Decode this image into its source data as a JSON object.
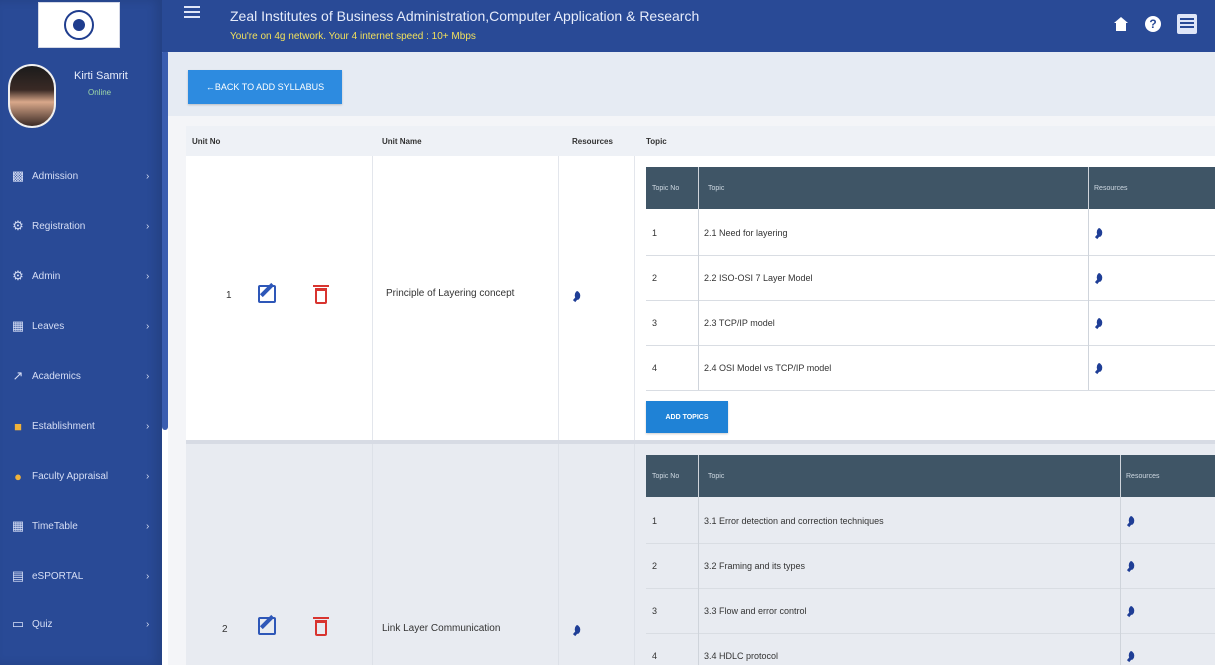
{
  "app": {
    "title": "Zeal Institutes of Business Administration,Computer Application & Research",
    "network_status": "You're on 4g network. Your 4 internet speed : 10+ Mbps"
  },
  "user": {
    "name": "Kirti Samrit",
    "status": "Online"
  },
  "sidebar": {
    "items": [
      {
        "label": "Admission",
        "icon": "id-card-icon"
      },
      {
        "label": "Registration",
        "icon": "gear-icon"
      },
      {
        "label": "Admin",
        "icon": "cogs-icon"
      },
      {
        "label": "Leaves",
        "icon": "calendar-icon"
      },
      {
        "label": "Academics",
        "icon": "chart-icon"
      },
      {
        "label": "Establishment",
        "icon": "briefcase-icon"
      },
      {
        "label": "Faculty Appraisal",
        "icon": "comment-icon"
      },
      {
        "label": "TimeTable",
        "icon": "calendar-icon"
      },
      {
        "label": "eSPORTAL",
        "icon": "document-icon"
      },
      {
        "label": "Quiz",
        "icon": "monitor-icon"
      }
    ]
  },
  "toolbar": {
    "back_label": "←BACK TO ADD SYLLABUS"
  },
  "table": {
    "headers": {
      "unit_no": "Unit No",
      "unit_name": "Unit Name",
      "resources": "Resources",
      "topic": "Topic"
    },
    "topic_headers": {
      "topic_no": "Topic No",
      "topic": "Topic",
      "resources": "Resources"
    },
    "units": [
      {
        "unit_no": "1",
        "unit_name": "Principle of Layering concept",
        "topics": [
          {
            "no": "1",
            "topic": "2.1 Need for layering"
          },
          {
            "no": "2",
            "topic": "2.2 ISO-OSI 7 Layer Model"
          },
          {
            "no": "3",
            "topic": "2.3 TCP/IP model"
          },
          {
            "no": "4",
            "topic": "2.4 OSI Model vs TCP/IP model"
          }
        ]
      },
      {
        "unit_no": "2",
        "unit_name": "Link Layer Communication",
        "topics": [
          {
            "no": "1",
            "topic": "3.1 Error detection and correction techniques"
          },
          {
            "no": "2",
            "topic": "3.2 Framing and its types"
          },
          {
            "no": "3",
            "topic": "3.3 Flow and error control"
          },
          {
            "no": "4",
            "topic": "3.4 HDLC protocol"
          }
        ]
      }
    ],
    "add_topics_label": "ADD TOPICS"
  },
  "colors": {
    "primary": "#294a96",
    "button": "#2d8be0",
    "header_dark": "#3f5566",
    "danger": "#d8342f"
  }
}
